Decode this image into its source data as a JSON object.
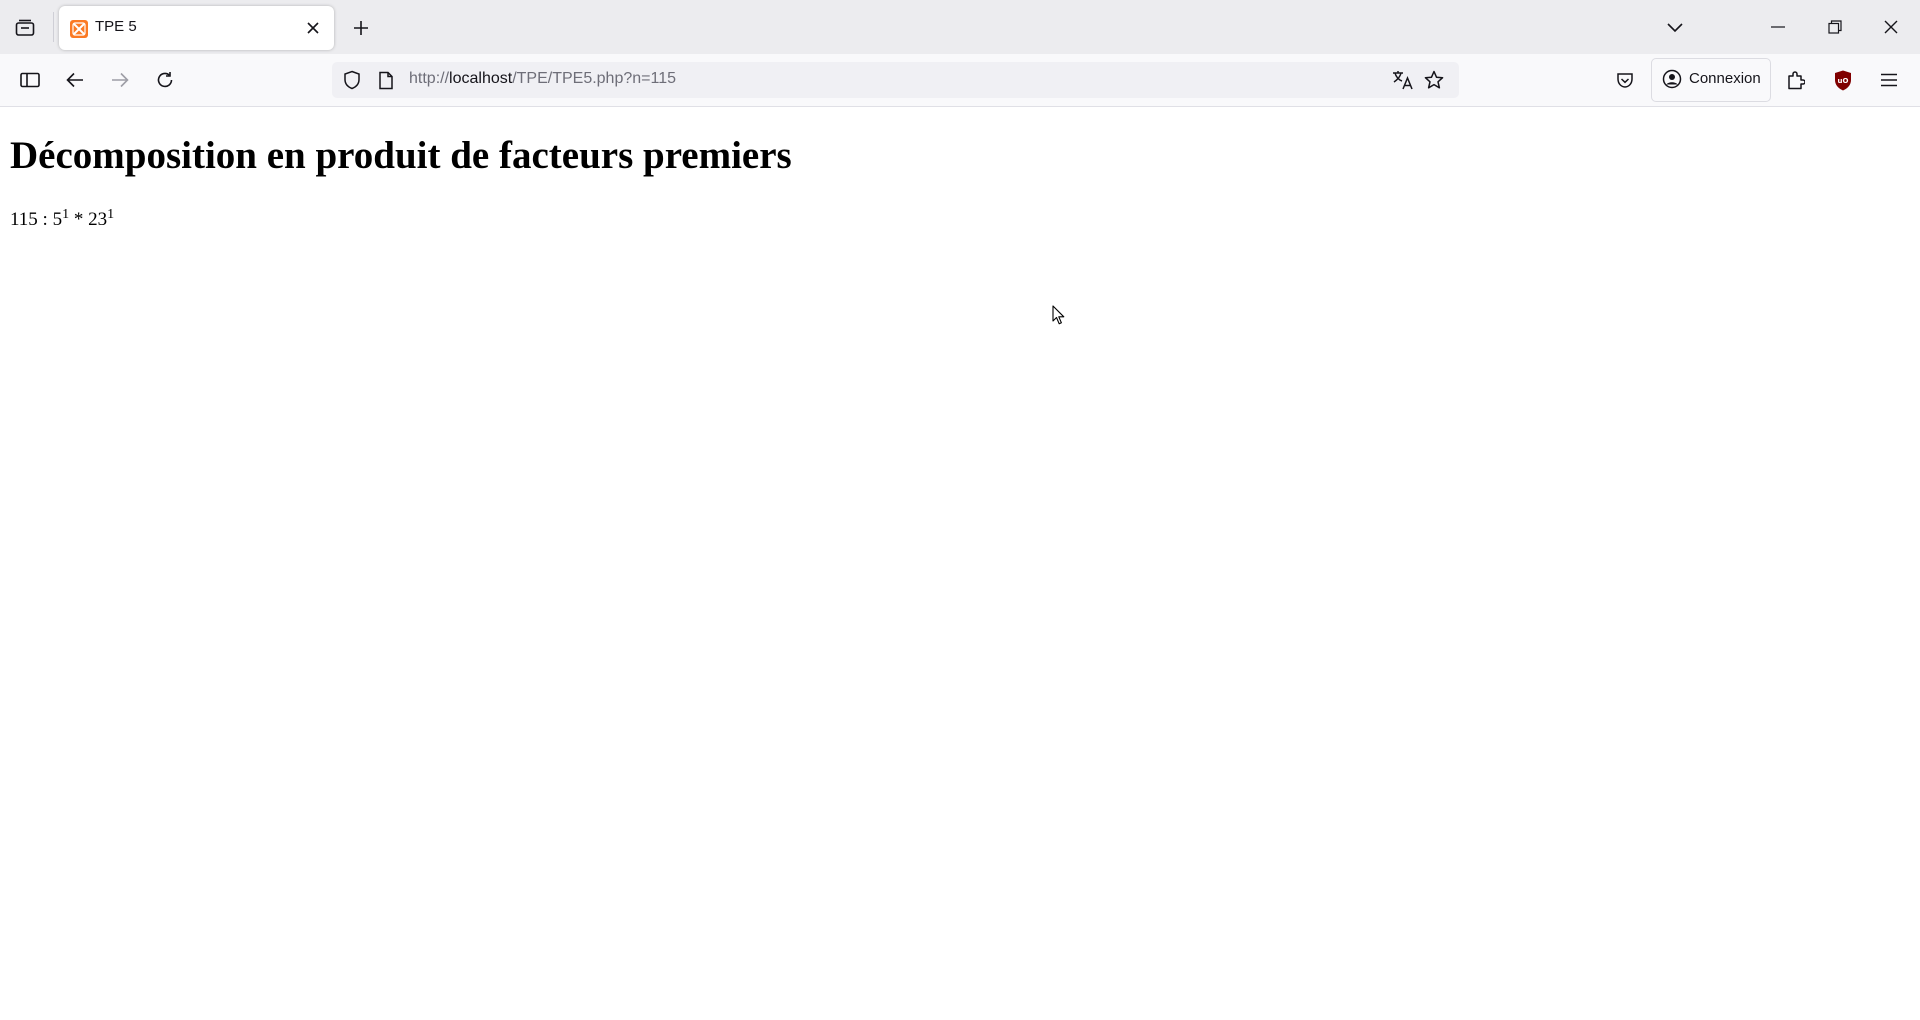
{
  "browser": {
    "tab": {
      "title": "TPE 5",
      "favicon": "xampp-icon"
    },
    "url": {
      "prefix": "http://",
      "host": "localhost",
      "path": "/TPE/TPE5.php?n=115"
    },
    "account_label": "Connexion",
    "colors": {
      "favicon_bg": "#fb7a24",
      "ublock_red": "#800000",
      "chrome_bg": "#ececef"
    }
  },
  "page": {
    "heading": "Décomposition en produit de facteurs premiers",
    "result": {
      "number": "115",
      "separator": " : ",
      "factor1": "5",
      "exp1": "1",
      "operator": " * ",
      "factor2": "23",
      "exp2": "1"
    }
  }
}
